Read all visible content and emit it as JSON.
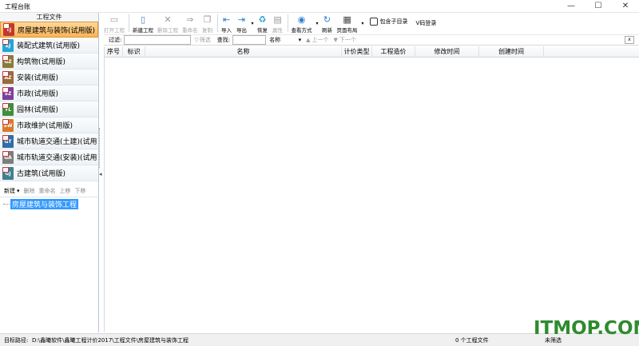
{
  "window": {
    "title": "工程台账",
    "controls": [
      "—",
      "☐",
      "✕"
    ]
  },
  "left_panel": {
    "header": "工程文件",
    "categories": [
      {
        "label": "房屋建筑与装饰(试用版)",
        "code": "TJ",
        "color": "#c0392b",
        "active": true
      },
      {
        "label": "装配式建筑(试用版)",
        "code": "ZJ",
        "color": "#23a6d6",
        "active": false
      },
      {
        "label": "构筑物(试用版)",
        "code": "GZ",
        "color": "#8a7a3a",
        "active": false
      },
      {
        "label": "安装(试用版)",
        "code": "AZ",
        "color": "#9a6a3a",
        "active": false
      },
      {
        "label": "市政(试用版)",
        "code": "SZ",
        "color": "#7b3fa0",
        "active": false
      },
      {
        "label": "园林(试用版)",
        "code": "YL",
        "color": "#3c8f3c",
        "active": false
      },
      {
        "label": "市政维护(试用版)",
        "code": "SW",
        "color": "#d77a2a",
        "active": false
      },
      {
        "label": "城市轨道交通(土建)(试用",
        "code": "GT",
        "color": "#2c6ea8",
        "active": false
      },
      {
        "label": "城市轨道交通(安装)(试用",
        "code": "GA",
        "color": "#7d7d7d",
        "active": false
      },
      {
        "label": "古建筑(试用版)",
        "code": "GJ",
        "color": "#3f7f8f",
        "active": false
      }
    ],
    "toolbar": {
      "new": "新建",
      "delete": "删除",
      "rename": "重命名",
      "move_up": "上移",
      "move_down": "下移"
    },
    "tree": {
      "selected_node": "房屋建筑与装饰工程"
    }
  },
  "toolbar": {
    "buttons": [
      {
        "label": "打开工程",
        "icon": "folder-icon",
        "glyph": "▭",
        "enabled": false,
        "color": "#999"
      },
      {
        "label": "新建工程",
        "icon": "new-file-icon",
        "glyph": "▯",
        "enabled": true,
        "color": "#4a7fc1"
      },
      {
        "label": "删除工程",
        "icon": "delete-icon",
        "glyph": "✕",
        "enabled": false,
        "color": "#999"
      },
      {
        "label": "重命名",
        "icon": "rename-icon",
        "glyph": "⇒",
        "enabled": false,
        "color": "#999"
      },
      {
        "label": "复制",
        "icon": "copy-icon",
        "glyph": "❐",
        "enabled": false,
        "color": "#999"
      },
      {
        "label": "导入",
        "icon": "import-icon",
        "glyph": "⇤",
        "enabled": true,
        "color": "#2f7fd0"
      },
      {
        "label": "导出",
        "icon": "export-icon",
        "glyph": "⇥",
        "enabled": true,
        "color": "#2f7fd0"
      },
      {
        "label": "恢复",
        "icon": "restore-icon",
        "glyph": "♻",
        "enabled": true,
        "color": "#2f9fd0"
      },
      {
        "label": "属性",
        "icon": "properties-icon",
        "glyph": "▤",
        "enabled": false,
        "color": "#999"
      },
      {
        "label": "查看方式",
        "icon": "view-mode-icon",
        "glyph": "◉",
        "enabled": true,
        "color": "#2f7fd0"
      },
      {
        "label": "刷新",
        "icon": "refresh-icon",
        "glyph": "↻",
        "enabled": true,
        "color": "#2f7fd0"
      },
      {
        "label": "页面布局",
        "icon": "page-layout-icon",
        "glyph": "▦",
        "enabled": true,
        "color": "#444"
      }
    ],
    "include_subdir_label": "包含子目录",
    "v_login_label": "V码登录"
  },
  "filter_bar": {
    "filter_label": "过滤:",
    "filter_button": "筛选",
    "search_label": "查找:",
    "search_field": "名称",
    "prev": "上一个",
    "next": "下一个",
    "close": "x"
  },
  "grid": {
    "columns": [
      "序号",
      "标识",
      "名称",
      "计价类型",
      "工程造价",
      "修改时间",
      "创建时间"
    ]
  },
  "status_bar": {
    "target_path_label": "目标路径:",
    "target_path": "D:\\鑫曦软件\\鑫曦工程计价2017\\工程文件\\房屋建筑与装饰工程",
    "file_count": "0 个工程文件",
    "filter_status": "未筛选"
  },
  "watermark": "ITMOP.COM"
}
